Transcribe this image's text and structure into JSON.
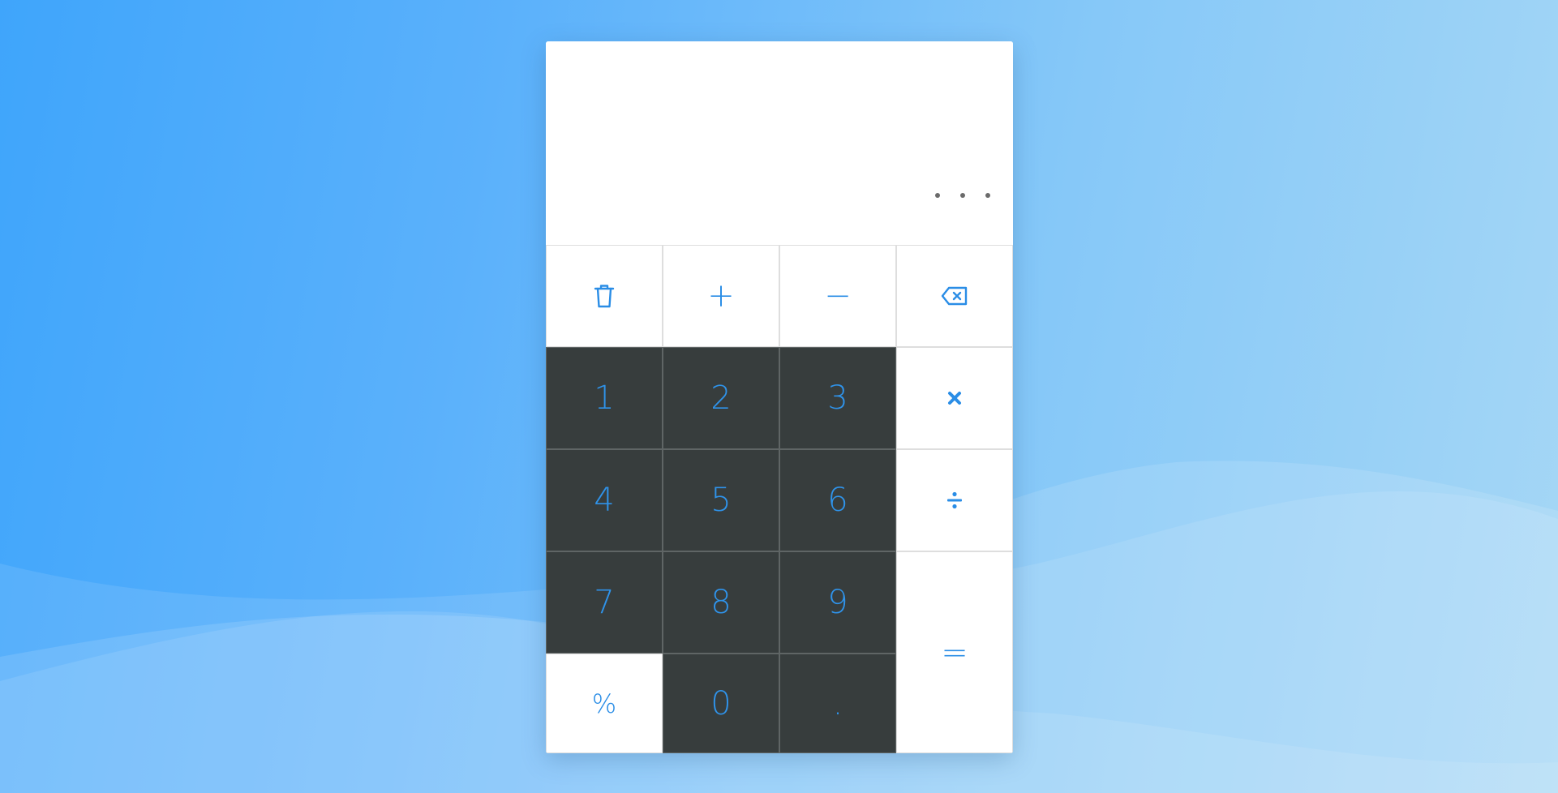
{
  "display": {
    "value": ""
  },
  "keys": {
    "one": "1",
    "two": "2",
    "three": "3",
    "four": "4",
    "five": "5",
    "six": "6",
    "seven": "7",
    "eight": "8",
    "nine": "9",
    "zero": "0",
    "decimal": ".",
    "percent": "%",
    "plus": "+",
    "minus": "−",
    "equals": "="
  },
  "icons": {
    "clear": "trash-icon",
    "backspace": "backspace-icon",
    "multiply": "multiply-icon",
    "divide": "divide-icon",
    "more": "more-horizontal-icon"
  },
  "colors": {
    "accent": "#2a8de6",
    "dark_key": "#373d3d",
    "light_key": "#ffffff"
  }
}
